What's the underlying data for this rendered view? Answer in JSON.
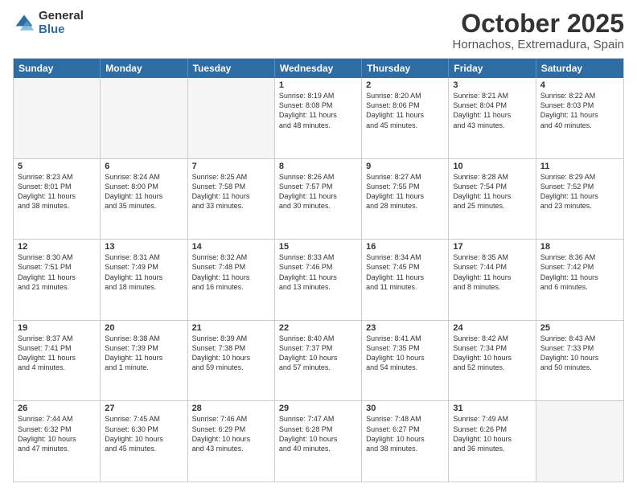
{
  "logo": {
    "general": "General",
    "blue": "Blue"
  },
  "header": {
    "month": "October 2025",
    "location": "Hornachos, Extremadura, Spain"
  },
  "weekdays": [
    "Sunday",
    "Monday",
    "Tuesday",
    "Wednesday",
    "Thursday",
    "Friday",
    "Saturday"
  ],
  "rows": [
    [
      {
        "day": "",
        "text": ""
      },
      {
        "day": "",
        "text": ""
      },
      {
        "day": "",
        "text": ""
      },
      {
        "day": "1",
        "text": "Sunrise: 8:19 AM\nSunset: 8:08 PM\nDaylight: 11 hours\nand 48 minutes."
      },
      {
        "day": "2",
        "text": "Sunrise: 8:20 AM\nSunset: 8:06 PM\nDaylight: 11 hours\nand 45 minutes."
      },
      {
        "day": "3",
        "text": "Sunrise: 8:21 AM\nSunset: 8:04 PM\nDaylight: 11 hours\nand 43 minutes."
      },
      {
        "day": "4",
        "text": "Sunrise: 8:22 AM\nSunset: 8:03 PM\nDaylight: 11 hours\nand 40 minutes."
      }
    ],
    [
      {
        "day": "5",
        "text": "Sunrise: 8:23 AM\nSunset: 8:01 PM\nDaylight: 11 hours\nand 38 minutes."
      },
      {
        "day": "6",
        "text": "Sunrise: 8:24 AM\nSunset: 8:00 PM\nDaylight: 11 hours\nand 35 minutes."
      },
      {
        "day": "7",
        "text": "Sunrise: 8:25 AM\nSunset: 7:58 PM\nDaylight: 11 hours\nand 33 minutes."
      },
      {
        "day": "8",
        "text": "Sunrise: 8:26 AM\nSunset: 7:57 PM\nDaylight: 11 hours\nand 30 minutes."
      },
      {
        "day": "9",
        "text": "Sunrise: 8:27 AM\nSunset: 7:55 PM\nDaylight: 11 hours\nand 28 minutes."
      },
      {
        "day": "10",
        "text": "Sunrise: 8:28 AM\nSunset: 7:54 PM\nDaylight: 11 hours\nand 25 minutes."
      },
      {
        "day": "11",
        "text": "Sunrise: 8:29 AM\nSunset: 7:52 PM\nDaylight: 11 hours\nand 23 minutes."
      }
    ],
    [
      {
        "day": "12",
        "text": "Sunrise: 8:30 AM\nSunset: 7:51 PM\nDaylight: 11 hours\nand 21 minutes."
      },
      {
        "day": "13",
        "text": "Sunrise: 8:31 AM\nSunset: 7:49 PM\nDaylight: 11 hours\nand 18 minutes."
      },
      {
        "day": "14",
        "text": "Sunrise: 8:32 AM\nSunset: 7:48 PM\nDaylight: 11 hours\nand 16 minutes."
      },
      {
        "day": "15",
        "text": "Sunrise: 8:33 AM\nSunset: 7:46 PM\nDaylight: 11 hours\nand 13 minutes."
      },
      {
        "day": "16",
        "text": "Sunrise: 8:34 AM\nSunset: 7:45 PM\nDaylight: 11 hours\nand 11 minutes."
      },
      {
        "day": "17",
        "text": "Sunrise: 8:35 AM\nSunset: 7:44 PM\nDaylight: 11 hours\nand 8 minutes."
      },
      {
        "day": "18",
        "text": "Sunrise: 8:36 AM\nSunset: 7:42 PM\nDaylight: 11 hours\nand 6 minutes."
      }
    ],
    [
      {
        "day": "19",
        "text": "Sunrise: 8:37 AM\nSunset: 7:41 PM\nDaylight: 11 hours\nand 4 minutes."
      },
      {
        "day": "20",
        "text": "Sunrise: 8:38 AM\nSunset: 7:39 PM\nDaylight: 11 hours\nand 1 minute."
      },
      {
        "day": "21",
        "text": "Sunrise: 8:39 AM\nSunset: 7:38 PM\nDaylight: 10 hours\nand 59 minutes."
      },
      {
        "day": "22",
        "text": "Sunrise: 8:40 AM\nSunset: 7:37 PM\nDaylight: 10 hours\nand 57 minutes."
      },
      {
        "day": "23",
        "text": "Sunrise: 8:41 AM\nSunset: 7:35 PM\nDaylight: 10 hours\nand 54 minutes."
      },
      {
        "day": "24",
        "text": "Sunrise: 8:42 AM\nSunset: 7:34 PM\nDaylight: 10 hours\nand 52 minutes."
      },
      {
        "day": "25",
        "text": "Sunrise: 8:43 AM\nSunset: 7:33 PM\nDaylight: 10 hours\nand 50 minutes."
      }
    ],
    [
      {
        "day": "26",
        "text": "Sunrise: 7:44 AM\nSunset: 6:32 PM\nDaylight: 10 hours\nand 47 minutes."
      },
      {
        "day": "27",
        "text": "Sunrise: 7:45 AM\nSunset: 6:30 PM\nDaylight: 10 hours\nand 45 minutes."
      },
      {
        "day": "28",
        "text": "Sunrise: 7:46 AM\nSunset: 6:29 PM\nDaylight: 10 hours\nand 43 minutes."
      },
      {
        "day": "29",
        "text": "Sunrise: 7:47 AM\nSunset: 6:28 PM\nDaylight: 10 hours\nand 40 minutes."
      },
      {
        "day": "30",
        "text": "Sunrise: 7:48 AM\nSunset: 6:27 PM\nDaylight: 10 hours\nand 38 minutes."
      },
      {
        "day": "31",
        "text": "Sunrise: 7:49 AM\nSunset: 6:26 PM\nDaylight: 10 hours\nand 36 minutes."
      },
      {
        "day": "",
        "text": ""
      }
    ]
  ]
}
